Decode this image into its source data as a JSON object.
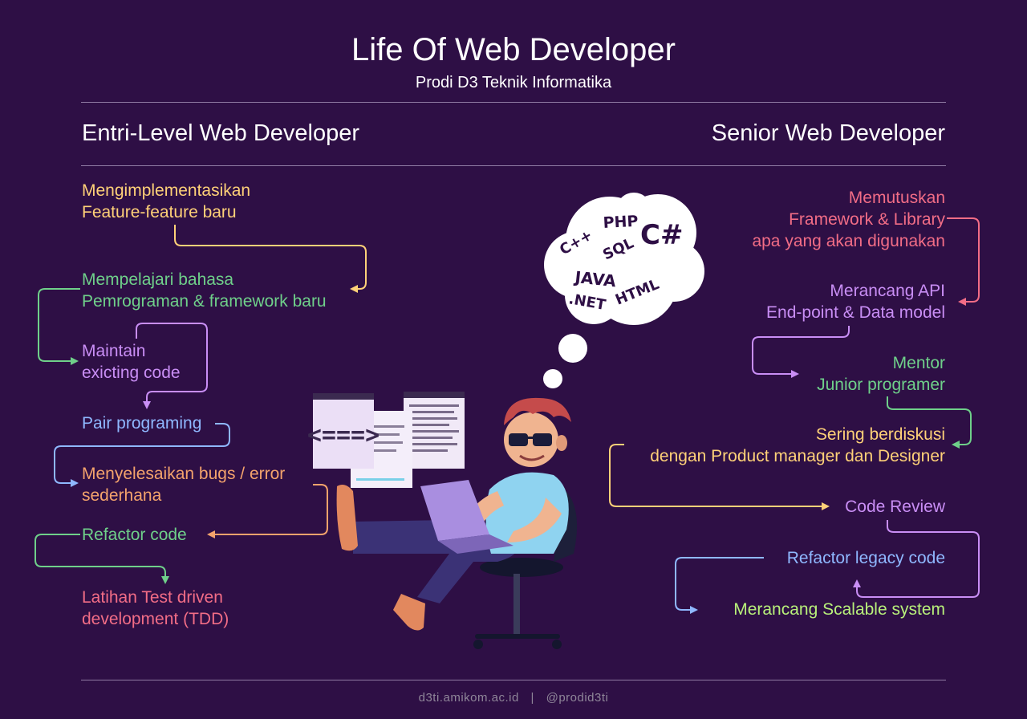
{
  "header": {
    "title": "Life Of Web Developer",
    "subtitle": "Prodi D3 Teknik Informatika"
  },
  "columns": {
    "left_title": "Entri-Level Web Developer",
    "right_title": "Senior Web Developer"
  },
  "entry_level": [
    {
      "text": "Mengimplementasikan\nFeature-feature baru",
      "color": "#ffd178"
    },
    {
      "text": "Mempelajari bahasa\nPemrograman & framework baru",
      "color": "#6fd08a"
    },
    {
      "text": "Maintain\nexicting code",
      "color": "#c98ef5"
    },
    {
      "text": "Pair programing",
      "color": "#8fb8ff"
    },
    {
      "text": "Menyelesaikan bugs / error\nsederhana",
      "color": "#f4a36c"
    },
    {
      "text": "Refactor code",
      "color": "#6fd08a"
    },
    {
      "text": "Latihan Test driven\ndevelopment (TDD)",
      "color": "#f26d86"
    }
  ],
  "senior": [
    {
      "text": "Memutuskan\nFramework & Library\napa yang akan digunakan",
      "color": "#f26d86"
    },
    {
      "text": "Merancang API\nEnd-point & Data model",
      "color": "#c98ef5"
    },
    {
      "text": "Mentor\nJunior programer",
      "color": "#6fd08a"
    },
    {
      "text": "Sering berdiskusi\ndengan Product manager dan Designer",
      "color": "#ffd178"
    },
    {
      "text": "Code Review",
      "color": "#c98ef5"
    },
    {
      "text": "Refactor legacy code",
      "color": "#8fb8ff"
    },
    {
      "text": "Merancang Scalable system",
      "color": "#b8f07a"
    }
  ],
  "thought_cloud": {
    "languages": [
      "PHP",
      "C#",
      "C++",
      "SQL",
      "JAVA",
      "HTML",
      ".NET"
    ]
  },
  "code_window_icon": "<===>",
  "footer": {
    "website": "d3ti.amikom.ac.id",
    "separator": "|",
    "social": "@prodid3ti"
  }
}
